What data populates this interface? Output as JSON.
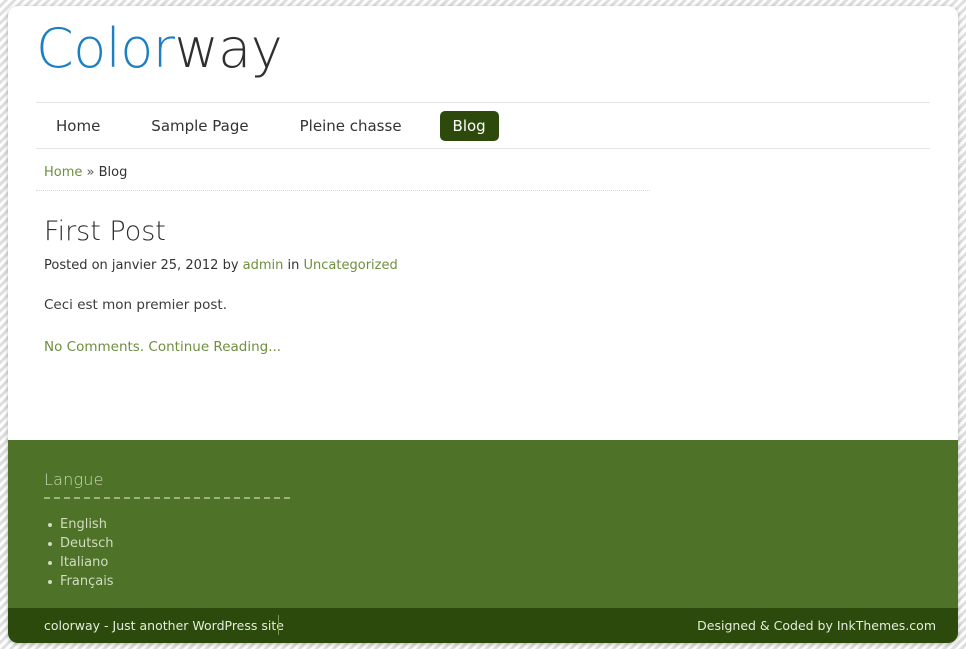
{
  "site": {
    "logo_part_one": "Color",
    "logo_part_two": "way",
    "logo_color_one": "#1b7fc1",
    "logo_color_two": "#2f2f2f"
  },
  "nav": {
    "items": [
      {
        "label": "Home",
        "active": false
      },
      {
        "label": "Sample Page",
        "active": false
      },
      {
        "label": "Pleine chasse",
        "active": false
      },
      {
        "label": "Blog",
        "active": true
      }
    ],
    "active_bg": "#2d4a0c"
  },
  "breadcrumb": {
    "home_label": "Home",
    "separator": "»",
    "current_label": "Blog"
  },
  "post": {
    "title": "First Post",
    "meta_prefix": "Posted on",
    "date": "janvier 25, 2012",
    "meta_by": "by",
    "author": "admin",
    "meta_in": "in",
    "category": "Uncategorized",
    "body": "Ceci est mon premier post.",
    "comments_link": "No Comments.",
    "continue_link": "Continue Reading..."
  },
  "footer": {
    "background": "#4d7228",
    "widget": {
      "title": "Langue",
      "items": [
        "English",
        "Deutsch",
        "Italiano",
        "Français"
      ]
    }
  },
  "bottom_bar": {
    "background": "#2b4a0b",
    "left_text": "colorway - Just another WordPress site",
    "right_text": "Designed & Coded by InkThemes.com"
  }
}
